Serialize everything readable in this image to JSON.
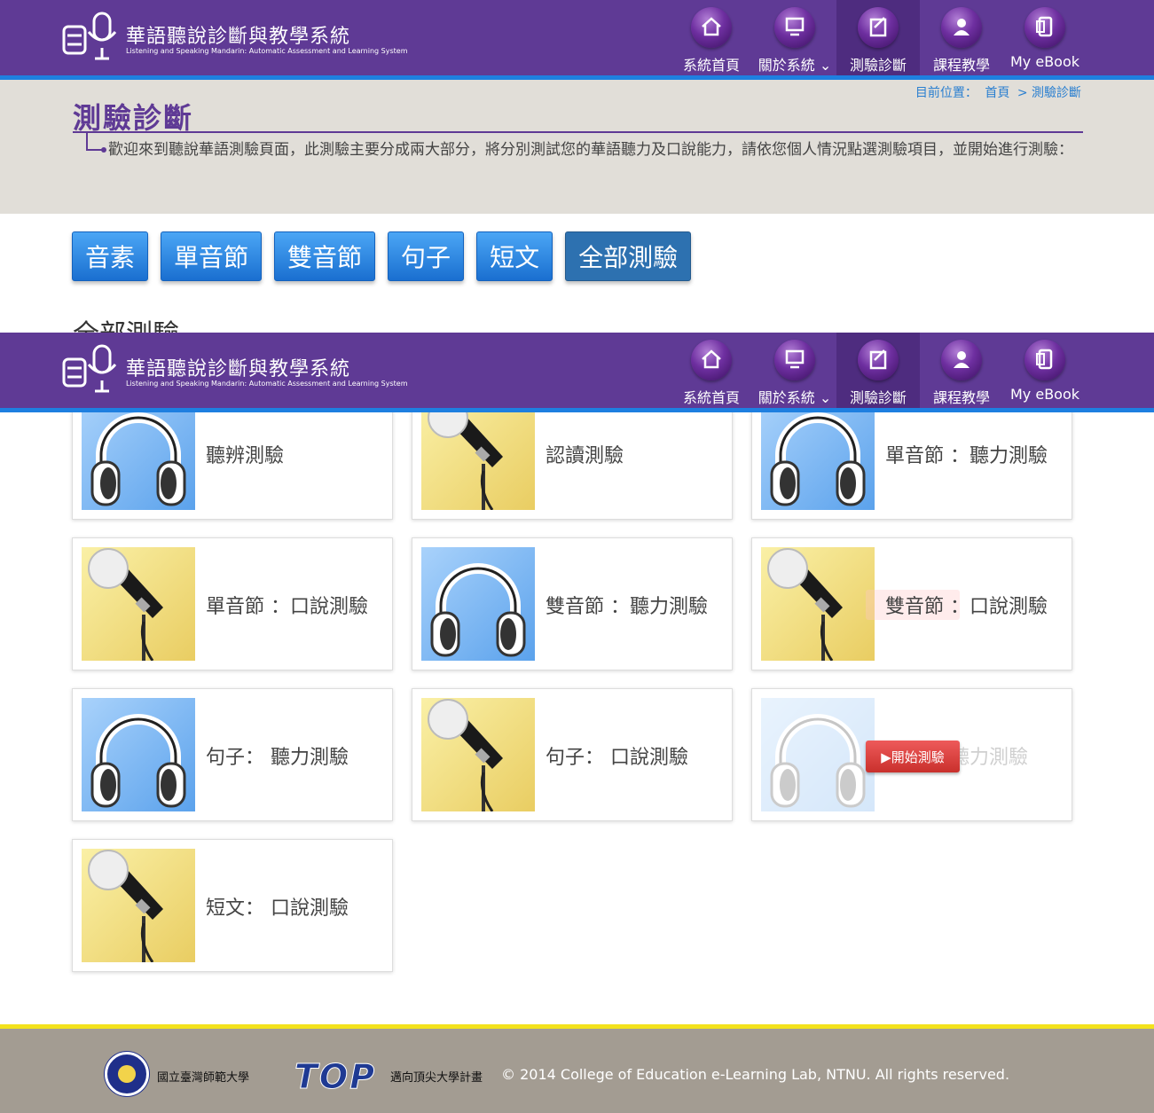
{
  "site": {
    "title": "華語聽說診斷與教學系統",
    "subtitle": "Listening and Speaking Mandarin: Automatic Assessment and Learning System"
  },
  "nav": [
    {
      "label": "系統首頁",
      "icon": "home-icon"
    },
    {
      "label": "關於系統",
      "icon": "monitor-icon"
    },
    {
      "label": "測驗診斷",
      "icon": "clipboard-icon"
    },
    {
      "label": "課程教學",
      "icon": "teacher-icon"
    },
    {
      "label": "My eBook",
      "icon": "ebook-icon"
    }
  ],
  "breadcrumb": {
    "prefix": "目前位置：",
    "home": "首頁",
    "current": "> 測驗診斷"
  },
  "page": {
    "title": "測驗診斷",
    "intro": "歡迎來到聽說華語測驗頁面，此測驗主要分成兩大部分，將分別測試您的華語聽力及口說能力，請依您個人情況點選測驗項目，並開始進行測驗："
  },
  "tabs": [
    "音素",
    "單音節",
    "雙音節",
    "句子",
    "短文",
    "全部測驗"
  ],
  "section_heading": "全部測驗",
  "cards": [
    {
      "title": "聽辨測驗",
      "kind": "headphones"
    },
    {
      "title": "認讀測驗",
      "kind": "microphone"
    },
    {
      "title": "單音節 ：聽力測驗",
      "kind": "headphones"
    },
    {
      "title": "單音節 ：口說測驗",
      "kind": "microphone"
    },
    {
      "title": "雙音節 ：聽力測驗",
      "kind": "headphones"
    },
    {
      "title": "雙音節 ：口說測驗",
      "kind": "microphone"
    },
    {
      "title": "句子： 聽力測驗",
      "kind": "headphones"
    },
    {
      "title": "句子： 口說測驗",
      "kind": "microphone"
    },
    {
      "title": "短文： 聽力測驗",
      "kind": "headphones"
    },
    {
      "title": "短文： 口說測驗",
      "kind": "microphone"
    }
  ],
  "start_button": "▶開始測驗",
  "footer": {
    "university": "國立臺灣師範大學",
    "top_logo": "TOP",
    "top_desc": "邁向頂尖大學計畫",
    "copyright": "© 2014 College of Education e-Learning Lab, NTNU. All rights reserved."
  },
  "colors": {
    "header": "#5f3a95",
    "accent_blue": "#1e7fe0",
    "footer_bar": "#f3e21c",
    "start_red": "#d9534f"
  }
}
